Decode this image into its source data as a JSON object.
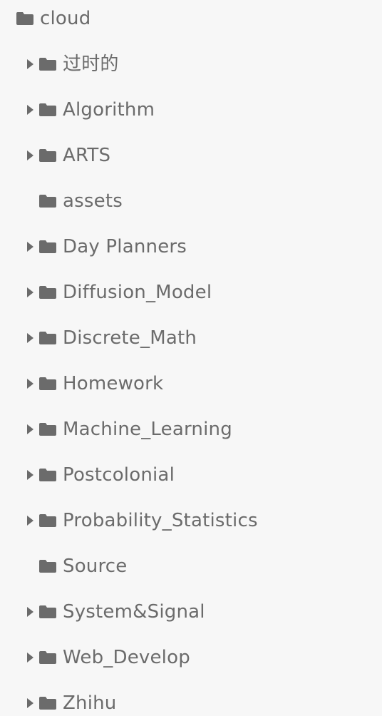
{
  "root": {
    "label": "cloud",
    "icon": "folder-icon"
  },
  "children": [
    {
      "label": "过时的",
      "expandable": true
    },
    {
      "label": "Algorithm",
      "expandable": true
    },
    {
      "label": "ARTS",
      "expandable": true
    },
    {
      "label": "assets",
      "expandable": false
    },
    {
      "label": "Day Planners",
      "expandable": true
    },
    {
      "label": "Diffusion_Model",
      "expandable": true
    },
    {
      "label": "Discrete_Math",
      "expandable": true
    },
    {
      "label": "Homework",
      "expandable": true
    },
    {
      "label": "Machine_Learning",
      "expandable": true
    },
    {
      "label": "Postcolonial",
      "expandable": true
    },
    {
      "label": "Probability_Statistics",
      "expandable": true
    },
    {
      "label": "Source",
      "expandable": false
    },
    {
      "label": "System&Signal",
      "expandable": true
    },
    {
      "label": "Web_Develop",
      "expandable": true
    },
    {
      "label": "Zhihu",
      "expandable": true
    }
  ],
  "colors": {
    "background": "#f7f7f7",
    "icon": "#6b6b6b",
    "text": "#6b6b6b"
  }
}
